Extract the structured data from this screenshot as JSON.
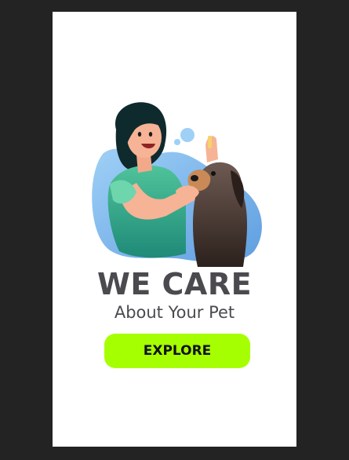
{
  "hero": {
    "illustration_icon": "woman-with-dog-illustration",
    "title": "WE CARE",
    "subtitle": "About Your Pet"
  },
  "cta": {
    "label": "EXPLORE",
    "color": "#a6ff00"
  },
  "colors": {
    "frame_background": "#232323",
    "screen_background": "#ffffff",
    "text": "#4a4a4f",
    "blob": "#7fb6e8"
  }
}
